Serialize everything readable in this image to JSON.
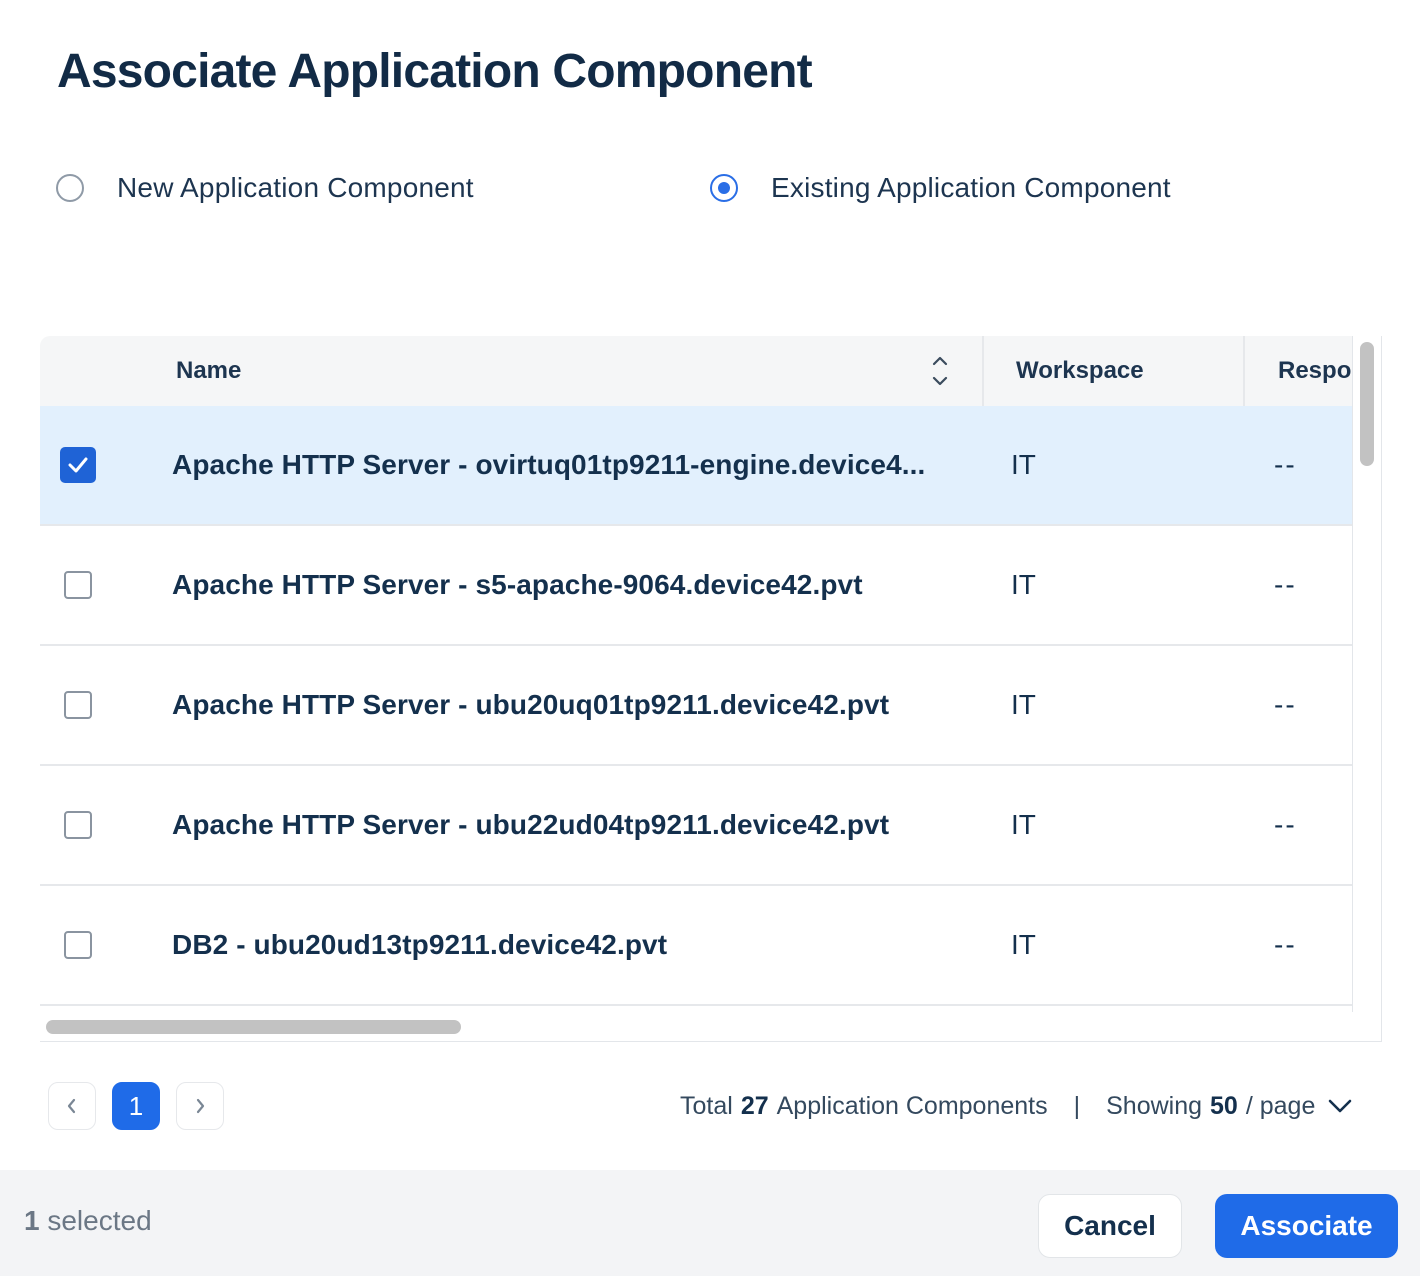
{
  "dialog": {
    "title": "Associate Application Component"
  },
  "mode": {
    "options": [
      {
        "label": "New Application Component",
        "selected": false
      },
      {
        "label": "Existing Application Component",
        "selected": true
      }
    ]
  },
  "table": {
    "columns": {
      "name": "Name",
      "workspace": "Workspace",
      "responsible": "Respo"
    },
    "rows": [
      {
        "name": "Apache HTTP Server - ovirtuq01tp9211-engine.device4...",
        "workspace": "IT",
        "responsible": "--",
        "checked": true
      },
      {
        "name": "Apache HTTP Server - s5-apache-9064.device42.pvt",
        "workspace": "IT",
        "responsible": "--",
        "checked": false
      },
      {
        "name": "Apache HTTP Server - ubu20uq01tp9211.device42.pvt",
        "workspace": "IT",
        "responsible": "--",
        "checked": false
      },
      {
        "name": "Apache HTTP Server - ubu22ud04tp9211.device42.pvt",
        "workspace": "IT",
        "responsible": "--",
        "checked": false
      },
      {
        "name": "DB2 - ubu20ud13tp9211.device42.pvt",
        "workspace": "IT",
        "responsible": "--",
        "checked": false
      }
    ]
  },
  "pagination": {
    "current_page": "1",
    "total_prefix": "Total",
    "total_count": "27",
    "total_suffix": "Application Components",
    "separator": "|",
    "showing_prefix": "Showing",
    "page_size": "50",
    "page_size_suffix": "/ page"
  },
  "footer": {
    "selected_count": "1",
    "selected_label": "selected",
    "cancel_label": "Cancel",
    "associate_label": "Associate"
  },
  "colors": {
    "accent": "#1f6be8",
    "selected_row": "#e2f0fd",
    "title_text": "#122b46"
  }
}
